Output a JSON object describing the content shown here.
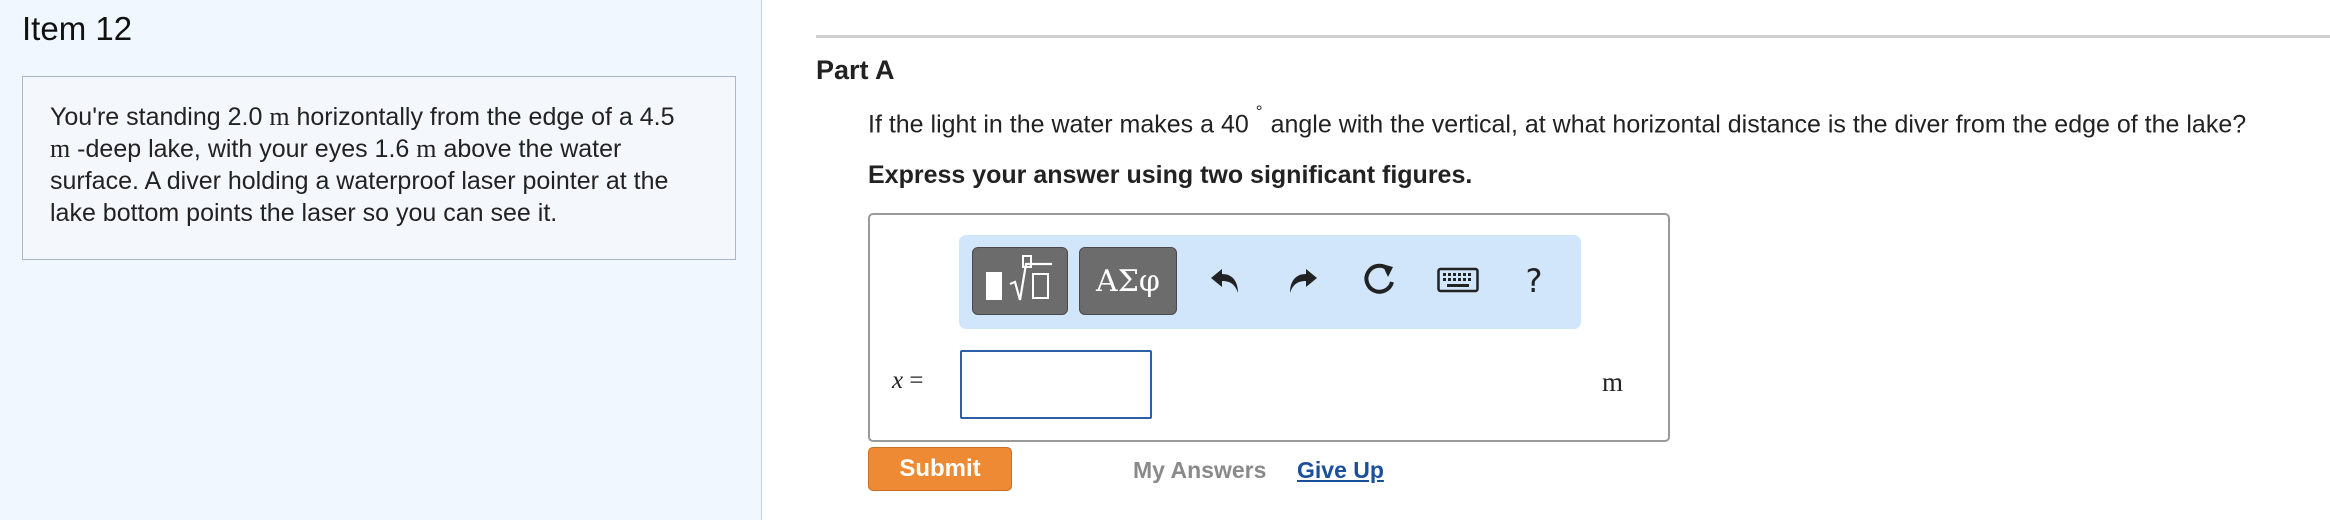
{
  "left": {
    "item_title": "Item 12",
    "problem": {
      "seg1": "You're standing 2.0 ",
      "unit1": "m",
      "seg2": " horizontally from the edge of a 4.5",
      "unit2": "m",
      "seg3": " -deep lake, with your eyes 1.6 ",
      "unit3": "m",
      "seg4": " above the water surface. A diver holding a waterproof laser pointer at the lake bottom points the laser so you can see it."
    }
  },
  "part": {
    "title": "Part A",
    "question_pre": "If the light in the water makes a 40",
    "question_degree": "°",
    "question_post": "angle with the vertical, at what horizontal distance is the diver from the edge of the lake?",
    "instruction": "Express your answer using two significant figures."
  },
  "toolbar": {
    "templates_icon": "templates-sqrt-icon",
    "greek_label": "ΑΣφ",
    "undo_icon": "undo-icon",
    "redo_icon": "redo-icon",
    "reset_icon": "reset-icon",
    "keyboard_icon": "keyboard-icon",
    "help_label": "?"
  },
  "answer": {
    "variable": "x",
    "equals": " =",
    "value": "",
    "unit": "m"
  },
  "actions": {
    "submit_label": "Submit",
    "my_answers_label": "My Answers",
    "give_up_label": "Give Up"
  },
  "colors": {
    "submit_bg": "#ee8a33",
    "toolbar_bg": "#d1e5fb",
    "link": "#1a4f9c",
    "left_panel_bg": "#f1f7ff"
  }
}
